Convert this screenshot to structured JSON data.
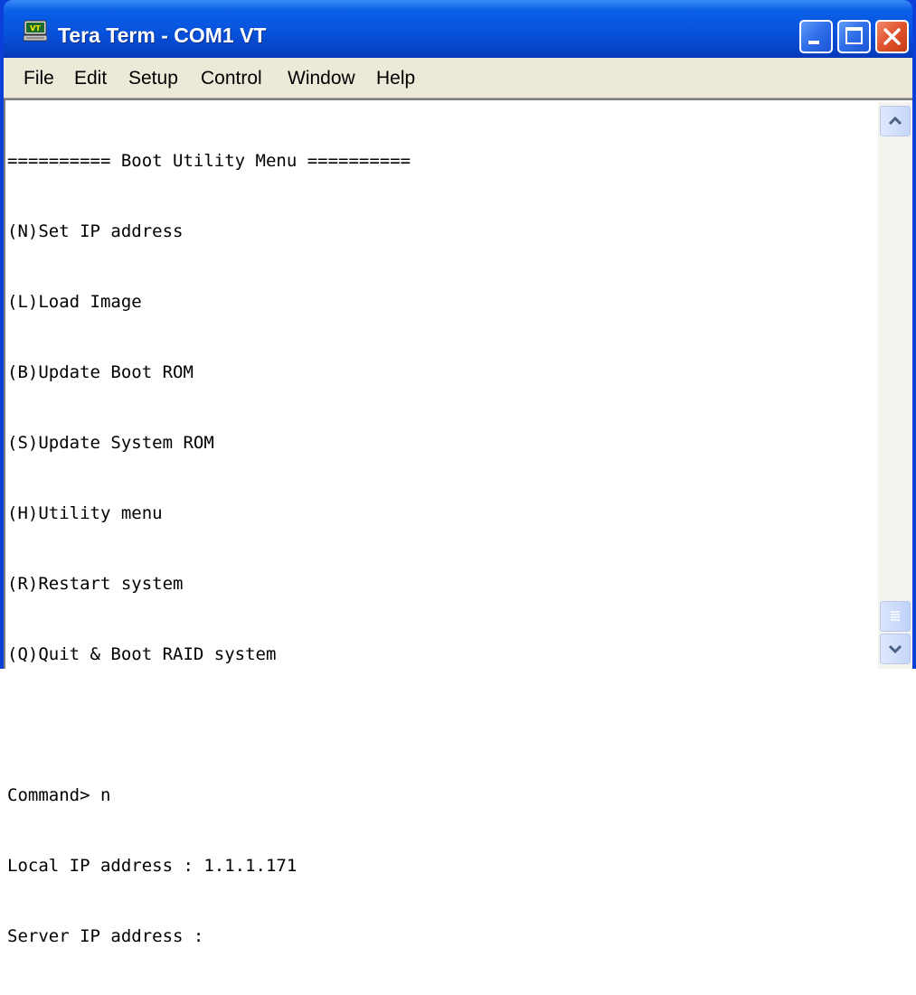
{
  "window": {
    "title": "Tera Term - COM1 VT",
    "icon": "terminal-vt-icon",
    "title_bar_color": "#0753dd"
  },
  "menubar": {
    "items": [
      "File",
      "Edit",
      "Setup",
      "Control",
      "Window",
      "Help"
    ]
  },
  "terminal": {
    "lines": [
      "========== Boot Utility Menu ==========",
      "(N)Set IP address",
      "(L)Load Image",
      "(B)Update Boot ROM",
      "(S)Update System ROM",
      "(H)Utility menu",
      "(R)Restart system",
      "(Q)Quit & Boot RAID system",
      "",
      "Command> n",
      "Local IP address : 1.1.1.171",
      "Server IP address :"
    ]
  },
  "scrollbar": {
    "up_icon": "scroll-up-arrow-icon",
    "down_icon": "scroll-down-arrow-icon",
    "position": 1.0
  }
}
